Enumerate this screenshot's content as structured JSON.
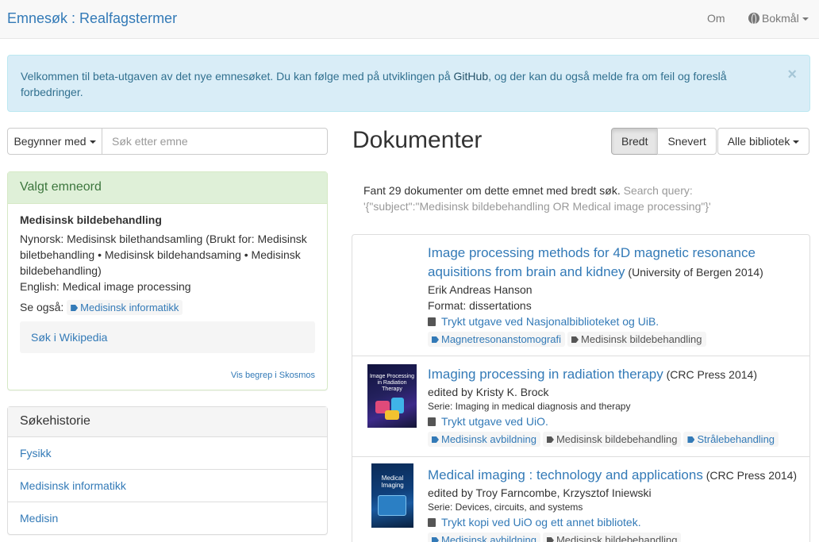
{
  "navbar": {
    "brand": "Emnesøk : Realfagstermer",
    "about": "Om",
    "language": "Bokmål"
  },
  "alert": {
    "text_before": "Velkommen til beta-utgaven av det nye emnesøket. Du kan følge med på utviklingen på ",
    "link": "GitHub",
    "text_after": ", og der kan du også melde fra om feil og foreslå forbedringer.",
    "close": "×"
  },
  "search": {
    "mode_label": "Begynner med",
    "placeholder": "Søk etter emne"
  },
  "selected_term": {
    "heading": "Valgt emneord",
    "term": "Medisinsk bildebehandling",
    "nynorsk": "Nynorsk: Medisinsk bilethandsamling (Brukt for: Medisinsk biletbehandling • Medisinsk bildehandsaming • Medisinsk bildebehandling)",
    "english": "English: Medical image processing",
    "see_also_label": "Se også:",
    "see_also": "Medisinsk informatikk",
    "wikipedia": "Søk i Wikipedia",
    "skosmos": "Vis begrep i Skosmos"
  },
  "history": {
    "heading": "Søkehistorie",
    "items": [
      "Fysikk",
      "Medisinsk informatikk",
      "Medisin"
    ]
  },
  "documents": {
    "heading": "Dokumenter",
    "scope_buttons": [
      "Bredt",
      "Snevert"
    ],
    "library_button": "Alle bibliotek",
    "summary": "Fant 29 dokumenter om dette emnet med bredt søk.",
    "query": "Search query: '{\"subject\":\"Medisinsk bildebehandling OR Medical image processing\"}'",
    "items": [
      {
        "title": "Image processing methods for 4D magnetic resonance aquisitions from brain and kidney",
        "publisher": "(University of Bergen 2014)",
        "line1": "Erik Andreas Hanson",
        "line2": "Format: dissertations",
        "availability": "Trykt utgave ved Nasjonalbiblioteket og UiB.",
        "tags": [
          "Magnetresonanstomografi",
          "Medisinsk bildebehandling"
        ]
      },
      {
        "title": "Imaging processing in radiation therapy",
        "publisher": "(CRC Press 2014)",
        "line1": "edited by Kristy K. Brock",
        "series": "Serie: Imaging in medical diagnosis and therapy",
        "availability": "Trykt utgave ved UiO.",
        "tags": [
          "Medisinsk avbildning",
          "Medisinsk bildebehandling",
          "Strålebehandling"
        ],
        "cover_text": "Image Processing in Radiation Therapy"
      },
      {
        "title": "Medical imaging : technology and applications",
        "publisher": "(CRC Press 2014)",
        "line1": "edited by Troy Farncombe, Krzysztof Iniewski",
        "series": "Serie: Devices, circuits, and systems",
        "availability": "Trykt kopi ved UiO og ett annet bibliotek.",
        "tags": [
          "Medisinsk avbildning",
          "Medisinsk bildebehandling"
        ],
        "cover_text": "Medical Imaging"
      }
    ]
  },
  "colors": {
    "link": "#337ab7",
    "alert_bg": "#d9edf7",
    "success_bg": "#dff0d8"
  }
}
